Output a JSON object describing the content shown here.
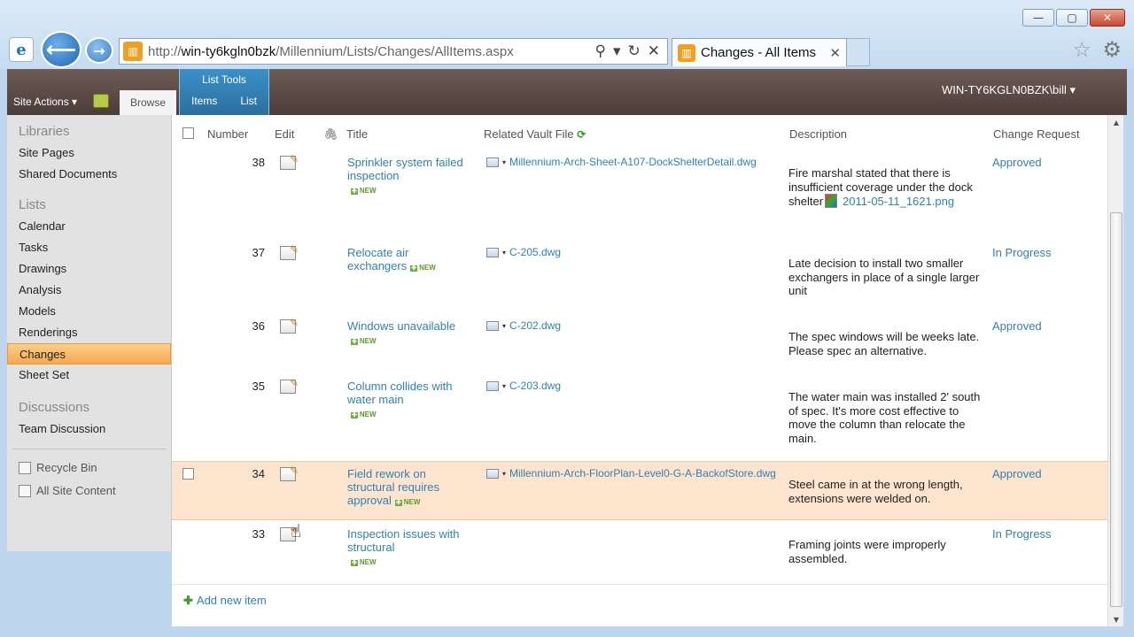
{
  "browser": {
    "url_prefix": "http://",
    "url_host": "win-ty6kgln0bzk",
    "url_path": "/Millennium/Lists/Changes/AllItems.aspx",
    "tab_title": "Changes - All Items",
    "min_glyph": "—",
    "max_glyph": "▢",
    "close_glyph": "✕",
    "back_glyph": "⟵",
    "fwd_glyph": "→",
    "search_glyph": "⚲",
    "dropdown_glyph": "▾",
    "refresh_glyph": "↻",
    "stop_glyph": "✕",
    "tab_close_glyph": "✕",
    "star_glyph": "☆",
    "gear_glyph": "⚙",
    "ie_glyph": "e",
    "site_glyph": "▥"
  },
  "ribbon": {
    "site_actions": "Site Actions ▾",
    "browse_tab": "Browse",
    "list_tools_label": "List Tools",
    "items_tab": "Items",
    "list_tab": "List",
    "user": "WIN-TY6KGLN0BZK\\bill ▾"
  },
  "quicklaunch": {
    "libraries_heading": "Libraries",
    "libraries": [
      "Site Pages",
      "Shared Documents"
    ],
    "lists_heading": "Lists",
    "lists": [
      "Calendar",
      "Tasks",
      "Drawings",
      "Analysis",
      "Models",
      "Renderings",
      "Changes",
      "Sheet Set"
    ],
    "selected": "Changes",
    "discussions_heading": "Discussions",
    "discussions": [
      "Team Discussion"
    ],
    "recycle_bin": "Recycle Bin",
    "all_site_content": "All Site Content"
  },
  "table": {
    "headers": {
      "number": "Number",
      "edit": "Edit",
      "attach_glyph": "🖇",
      "title": "Title",
      "vault_file": "Related Vault File",
      "refresh_glyph": "⟳",
      "description": "Description",
      "change_request": "Change Request"
    },
    "new_label": "NEW",
    "dropdown_glyph": "▾",
    "rows": [
      {
        "number": "38",
        "title": "Sprinkler system failed inspection",
        "vault_file": "Millennium-Arch-Sheet-A107-DockShelterDetail.dwg",
        "description": "Fire marshal stated that there is insufficient coverage under the dock shelter",
        "desc_link": "2011-05-11_1621.png",
        "status": "Approved"
      },
      {
        "number": "37",
        "title": "Relocate air exchangers",
        "vault_file": "C-205.dwg",
        "description": "Late decision to install two smaller exchangers in place of a single larger unit",
        "status": "In Progress"
      },
      {
        "number": "36",
        "title": "Windows unavailable",
        "vault_file": "C-202.dwg",
        "description": "The spec windows will be weeks late.  Please spec an alternative.",
        "status": "Approved"
      },
      {
        "number": "35",
        "title": "Column collides with water main",
        "vault_file": "C-203.dwg",
        "description": "The water main was installed 2' south of spec.  It's more cost effective to move the column than relocate the main.",
        "status": ""
      },
      {
        "number": "34",
        "title": "Field rework on structural requires approval",
        "vault_file": "Millennium-Arch-FloorPlan-Level0-G-A-BackofStore.dwg",
        "description": "Steel came in at the wrong length, extensions were welded on.",
        "status": "Approved"
      },
      {
        "number": "33",
        "title": "Inspection issues with structural",
        "vault_file": "",
        "description": "Framing joints were improperly assembled.",
        "status": "In Progress"
      }
    ]
  },
  "add_new_item": "Add new item",
  "add_glyph": "✚",
  "cursor_glyph": "☝"
}
